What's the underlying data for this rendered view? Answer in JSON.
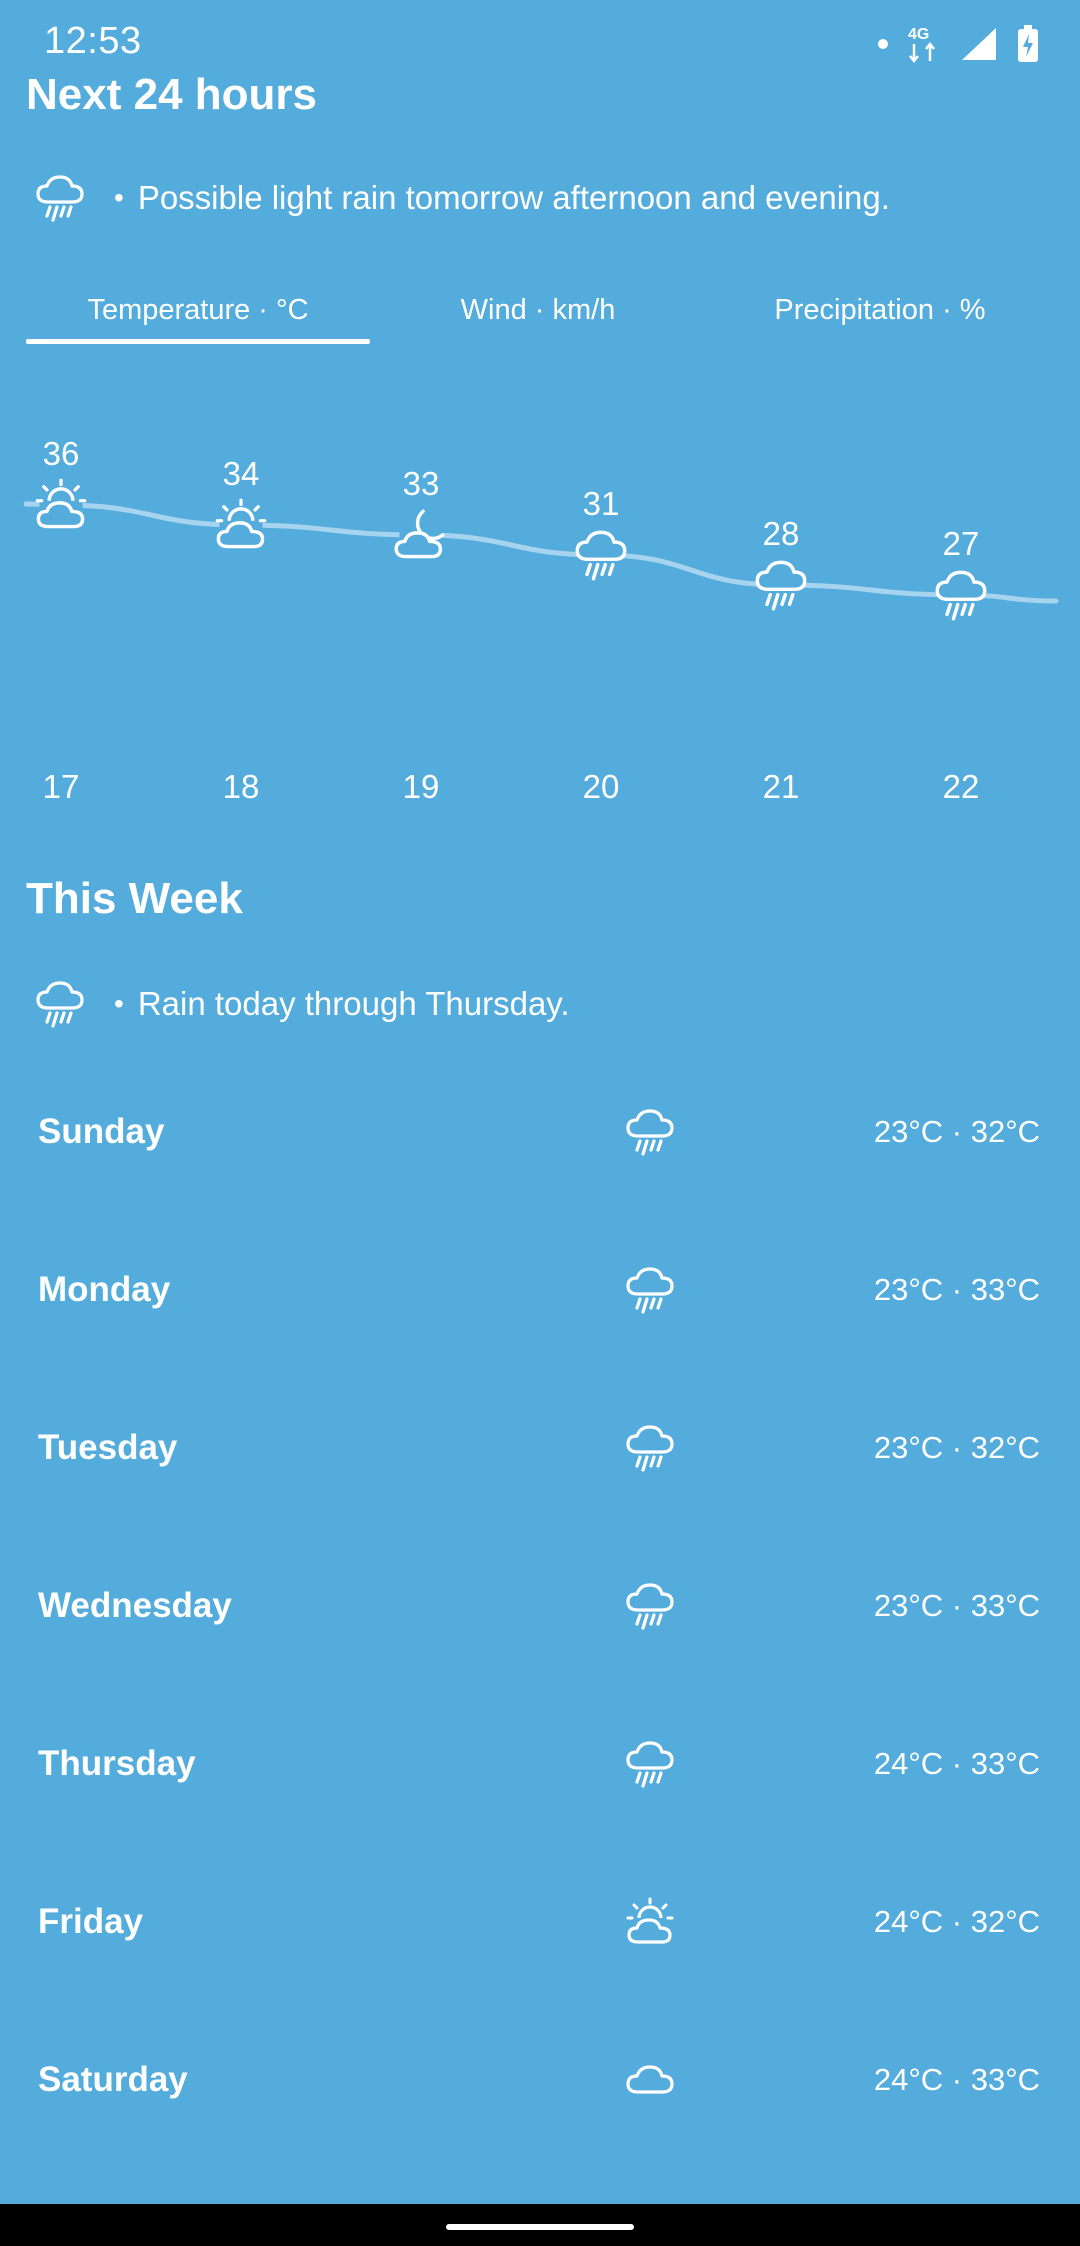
{
  "status": {
    "time": "12:53",
    "network": "4G",
    "icons": [
      "dot-icon",
      "4g-data-icon",
      "signal-icon",
      "battery-charging-icon"
    ]
  },
  "next24": {
    "heading": "Next 24 hours",
    "summary_icon": "rain-icon",
    "summary_text": "Possible light rain tomorrow afternoon and evening.",
    "tabs": [
      {
        "label": "Temperature · °C",
        "selected": true
      },
      {
        "label": "Wind · km/h",
        "selected": false
      },
      {
        "label": "Precipitation · %",
        "selected": false
      }
    ]
  },
  "chart_data": {
    "type": "line",
    "categories": [
      "17",
      "18",
      "19",
      "20",
      "21",
      "22"
    ],
    "values": [
      36,
      34,
      33,
      31,
      28,
      27
    ],
    "icons": [
      "partly-cloudy-day-icon",
      "partly-cloudy-day-icon",
      "partly-cloudy-night-icon",
      "rain-icon",
      "rain-icon",
      "rain-icon"
    ],
    "title": "",
    "xlabel": "",
    "ylabel": "",
    "grid": false,
    "line_color": "#a6d3ee"
  },
  "week": {
    "heading": "This Week",
    "summary_icon": "rain-icon",
    "summary_text": "Rain today through Thursday.",
    "days": [
      {
        "name": "Sunday",
        "icon": "rain-icon",
        "temps": "23°C · 32°C"
      },
      {
        "name": "Monday",
        "icon": "rain-icon",
        "temps": "23°C · 33°C"
      },
      {
        "name": "Tuesday",
        "icon": "rain-icon",
        "temps": "23°C · 32°C"
      },
      {
        "name": "Wednesday",
        "icon": "rain-icon",
        "temps": "23°C · 33°C"
      },
      {
        "name": "Thursday",
        "icon": "rain-icon",
        "temps": "24°C · 33°C"
      },
      {
        "name": "Friday",
        "icon": "partly-cloudy-day-icon",
        "temps": "24°C · 32°C"
      },
      {
        "name": "Saturday",
        "icon": "cloud-icon",
        "temps": "24°C · 33°C"
      }
    ]
  },
  "colors": {
    "background": "#54acdd",
    "foreground": "#ffffff",
    "chart_line": "#a6d3ee"
  }
}
